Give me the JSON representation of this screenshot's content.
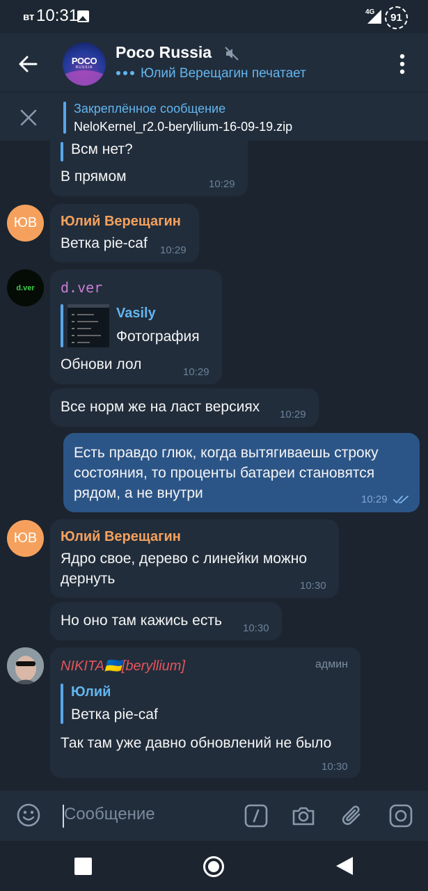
{
  "status_bar": {
    "day": "вт",
    "time": "10:31",
    "network": "4G",
    "battery": "91"
  },
  "header": {
    "title": "Poco Russia",
    "status": "Юлий Верещагин печатает",
    "avatar_logo": "POCO",
    "avatar_logo_sub": "RUSSIA"
  },
  "pinned": {
    "title": "Закреплённое сообщение",
    "text": "NeloKernel_r2.0-beryllium-16-09-19.zip"
  },
  "messages": [
    {
      "reply_fragment": "Всм нет?",
      "text": "В прямом",
      "time": "10:29"
    },
    {
      "avatar": "ЮВ",
      "sender": "Юлий Верещагин",
      "text": "Ветка pie-caf",
      "time": "10:29"
    },
    {
      "avatar": "d.ver",
      "sender": "d.ver",
      "reply_name": "Vasily",
      "reply_text": "Фотография",
      "text": "Обнови лол",
      "time": "10:29"
    },
    {
      "text": "Все норм же на ласт версиях",
      "time": "10:29"
    },
    {
      "text_lines": [
        "Есть правдо глюк, когда вытягиваешь строку",
        "состояния, то проценты батареи становятся",
        "рядом, а не внутри"
      ],
      "time": "10:29"
    },
    {
      "avatar": "ЮВ",
      "sender": "Юлий Верещагин",
      "text_lines": [
        "Ядро свое, дерево с линейки можно",
        "дернуть"
      ],
      "time": "10:30"
    },
    {
      "text": "Но оно там кажись есть",
      "time": "10:30"
    },
    {
      "sender": "NIKITA🇺🇦[beryllium]",
      "badge": "админ",
      "reply_name": "Юлий",
      "reply_text": "Ветка pie-caf",
      "text": "Так там уже давно обновлений не было",
      "time": "10:30"
    }
  ],
  "input": {
    "placeholder": "Сообщение"
  },
  "colors": {
    "background": "#1c242f",
    "bubble_in": "#212d3b",
    "bubble_out": "#2c5587",
    "accent": "#64b5ef",
    "sender_orange": "#f5a15d",
    "sender_purple": "#c77dd4",
    "sender_red": "#e5555d"
  }
}
